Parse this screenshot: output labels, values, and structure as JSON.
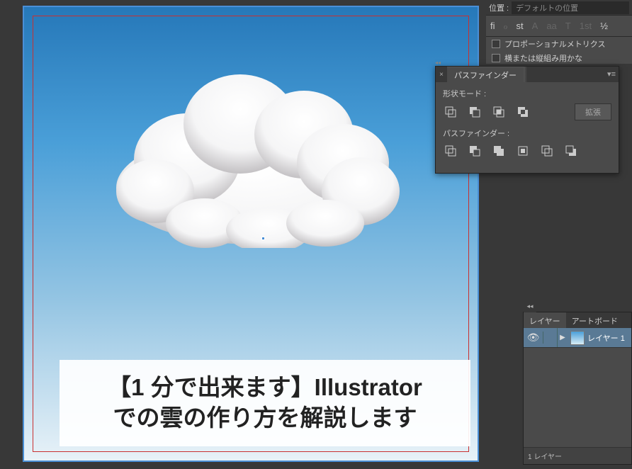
{
  "canvas": {
    "overlay_line1": "【1 分で出来ます】Illustrator",
    "overlay_line2": "での雲の作り方を解説します"
  },
  "top_panel": {
    "position_label": "位置 :",
    "position_value": "デフォルトの位置",
    "opentype_icons": [
      "fi",
      "ℴ",
      "st",
      "A",
      "aa",
      "T",
      "1st",
      "½"
    ],
    "checkbox1": "プロポーショナルメトリクス",
    "checkbox2": "横または縦組み用かな"
  },
  "pathfinder": {
    "tab": "パスファインダー",
    "shape_mode_label": "形状モード :",
    "pathfinder_label": "パスファインダー :",
    "expand_btn": "拡張"
  },
  "layers": {
    "tab_layers": "レイヤー",
    "tab_artboard": "アートボード",
    "layer1_name": "レイヤー 1",
    "footer": "1 レイヤー"
  }
}
